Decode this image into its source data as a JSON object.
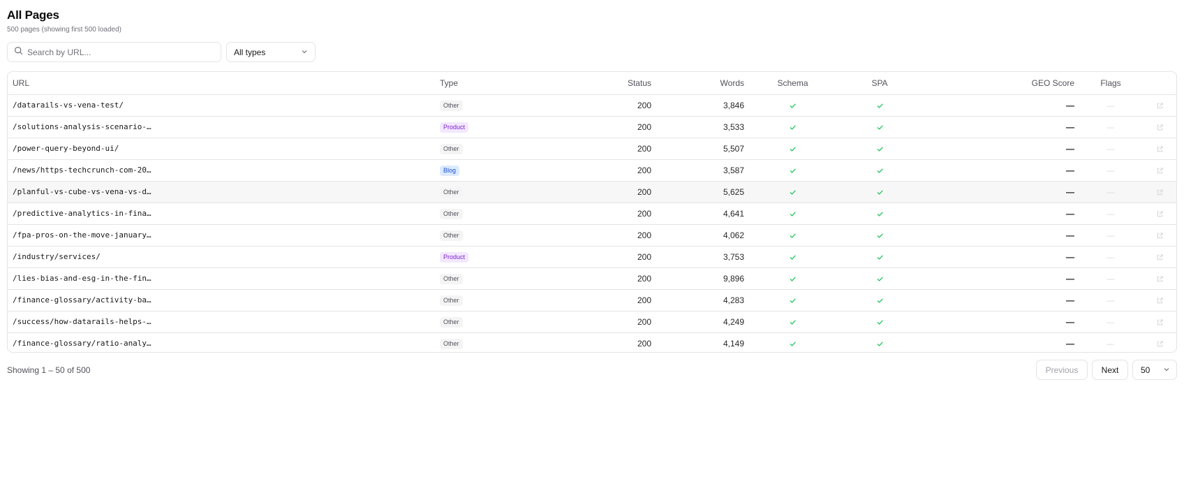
{
  "header": {
    "title": "All Pages",
    "subtitle": "500 pages (showing first 500 loaded)"
  },
  "filters": {
    "search_placeholder": "Search by URL...",
    "type_select": "All types"
  },
  "table": {
    "columns": {
      "url": "URL",
      "type": "Type",
      "status": "Status",
      "words": "Words",
      "schema": "Schema",
      "spa": "SPA",
      "geo_score": "GEO Score",
      "flags": "Flags"
    },
    "rows": [
      {
        "url": "/datarails-vs-vena-test/",
        "type": "Other",
        "status": "200",
        "words": "3,846",
        "schema": true,
        "spa": true,
        "geo": "—",
        "flags": "—"
      },
      {
        "url": "/solutions-analysis-scenario-…",
        "type": "Product",
        "status": "200",
        "words": "3,533",
        "schema": true,
        "spa": true,
        "geo": "—",
        "flags": "—"
      },
      {
        "url": "/power-query-beyond-ui/",
        "type": "Other",
        "status": "200",
        "words": "5,507",
        "schema": true,
        "spa": true,
        "geo": "—",
        "flags": "—"
      },
      {
        "url": "/news/https-techcrunch-com-20…",
        "type": "Blog",
        "status": "200",
        "words": "3,587",
        "schema": true,
        "spa": true,
        "geo": "—",
        "flags": "—"
      },
      {
        "url": "/planful-vs-cube-vs-vena-vs-d…",
        "type": "Other",
        "status": "200",
        "words": "5,625",
        "schema": true,
        "spa": true,
        "geo": "—",
        "flags": "—"
      },
      {
        "url": "/predictive-analytics-in-fina…",
        "type": "Other",
        "status": "200",
        "words": "4,641",
        "schema": true,
        "spa": true,
        "geo": "—",
        "flags": "—"
      },
      {
        "url": "/fpa-pros-on-the-move-january…",
        "type": "Other",
        "status": "200",
        "words": "4,062",
        "schema": true,
        "spa": true,
        "geo": "—",
        "flags": "—"
      },
      {
        "url": "/industry/services/",
        "type": "Product",
        "status": "200",
        "words": "3,753",
        "schema": true,
        "spa": true,
        "geo": "—",
        "flags": "—"
      },
      {
        "url": "/lies-bias-and-esg-in-the-fin…",
        "type": "Other",
        "status": "200",
        "words": "9,896",
        "schema": true,
        "spa": true,
        "geo": "—",
        "flags": "—"
      },
      {
        "url": "/finance-glossary/activity-ba…",
        "type": "Other",
        "status": "200",
        "words": "4,283",
        "schema": true,
        "spa": true,
        "geo": "—",
        "flags": "—"
      },
      {
        "url": "/success/how-datarails-helps-…",
        "type": "Other",
        "status": "200",
        "words": "4,249",
        "schema": true,
        "spa": true,
        "geo": "—",
        "flags": "—"
      },
      {
        "url": "/finance-glossary/ratio-analy…",
        "type": "Other",
        "status": "200",
        "words": "4,149",
        "schema": true,
        "spa": true,
        "geo": "—",
        "flags": "—"
      }
    ],
    "highlighted_row": 4
  },
  "footer": {
    "showing": "Showing 1 – 50 of 500",
    "previous_label": "Previous",
    "next_label": "Next",
    "page_size": "50"
  },
  "colors": {
    "check": "#22c55e",
    "product_badge": "#7e22ce",
    "blog_badge": "#1d4ed8"
  },
  "icons": [
    "search-icon",
    "chevron-down-icon",
    "check-icon",
    "external-link-icon"
  ]
}
